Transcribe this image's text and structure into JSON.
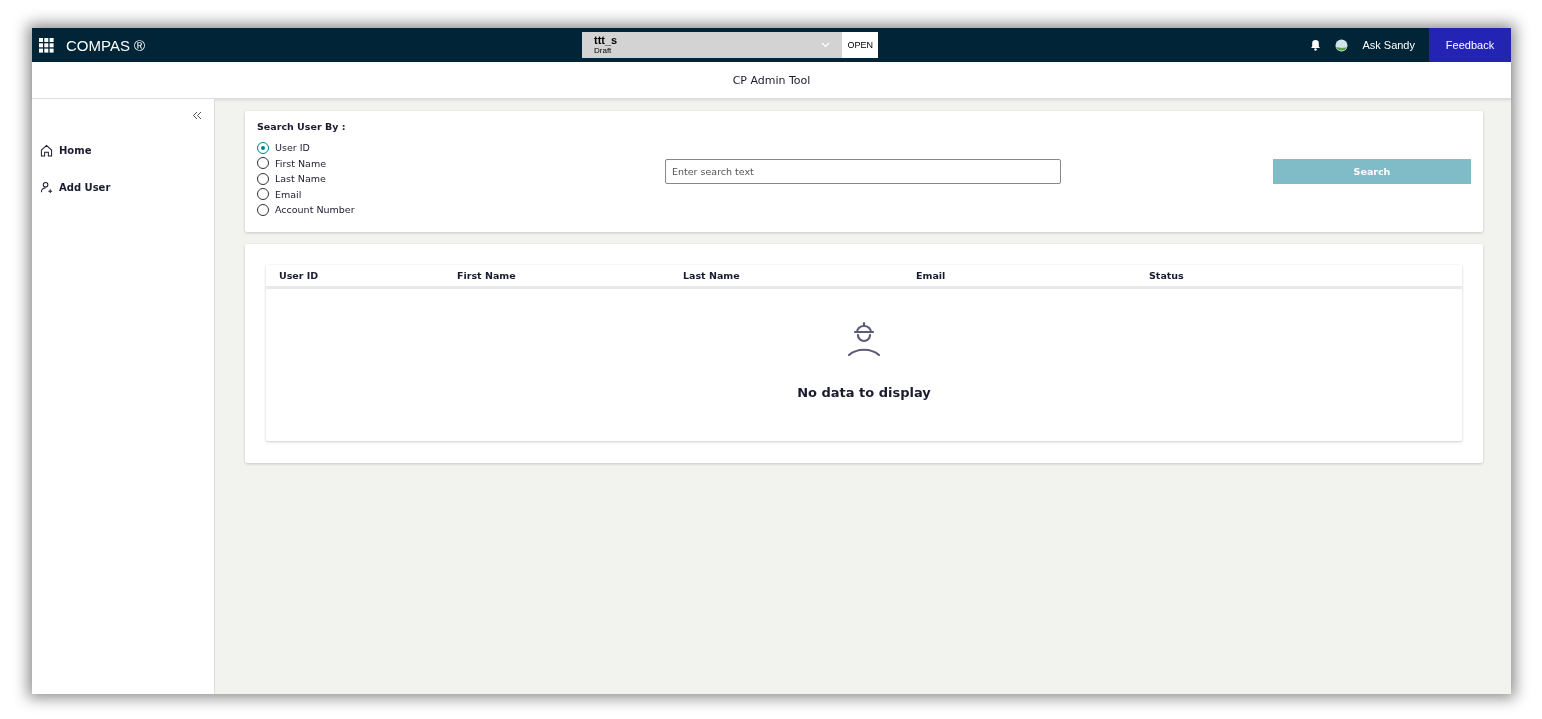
{
  "app": {
    "brand": "COMPAS ®",
    "project": {
      "name": "ttt_s",
      "status": "Draft",
      "action": "OPEN"
    },
    "assistant": "Ask Sandy",
    "feedback": "Feedback"
  },
  "page_title": "CP Admin Tool",
  "sidebar": {
    "items": [
      {
        "label": "Home",
        "kind": "home"
      },
      {
        "label": "Add User",
        "kind": "add-user"
      }
    ]
  },
  "search": {
    "title": "Search User By :",
    "options": [
      {
        "label": "User ID",
        "selected": true
      },
      {
        "label": "First Name",
        "selected": false
      },
      {
        "label": "Last Name",
        "selected": false
      },
      {
        "label": "Email",
        "selected": false
      },
      {
        "label": "Account Number",
        "selected": false
      }
    ],
    "placeholder": "Enter search text",
    "button": {
      "label": "Search",
      "disabled": true
    }
  },
  "table": {
    "columns": [
      "User ID",
      "First Name",
      "Last Name",
      "Email",
      "Status"
    ],
    "empty_text": "No data to display"
  }
}
